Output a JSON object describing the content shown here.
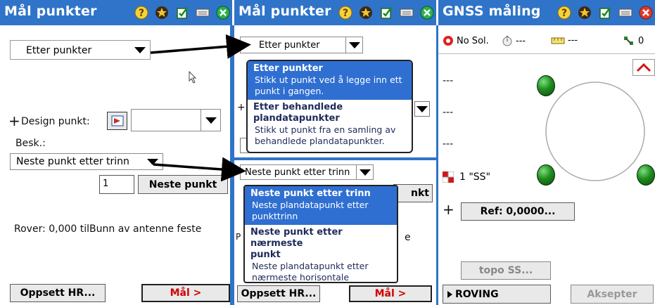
{
  "left": {
    "title": "Mål punkter",
    "method_dropdown": "Etter punkter",
    "plus": "+",
    "design_label": "Design punkt:",
    "besk_label": "Besk.:",
    "step_dropdown": "Neste punkt etter trinn",
    "number_value": "1",
    "next_button": "Neste punkt",
    "rover_text": "Rover: 0,000 tilBunn av antenne feste",
    "setup_button": "Oppsett HR...",
    "measure_button": "Mål >"
  },
  "middle": {
    "title": "Mål punkter",
    "method_dropdown": "Etter punkter",
    "method_options": [
      {
        "title": "Etter punkter",
        "desc_line1": "Stikk ut punkt ved å legge inn ett",
        "desc_line2": "punkt i gangen."
      },
      {
        "title_line1": "Etter behandlede",
        "title_line2": "plandatapunkter",
        "desc_line1": "Stikk ut punkt fra en samling av",
        "desc_line2": "behandlede plandatapunkter."
      }
    ],
    "step_dropdown": "Neste punkt etter trinn",
    "step_options": [
      {
        "title": "Neste punkt etter trinn",
        "desc_line1": "Neste plandatapunkt etter",
        "desc_line2": "punkttrinn"
      },
      {
        "title_line1": "Neste punkt etter nærmeste",
        "title_line2": "punkt",
        "desc_line1": "Neste plandatapunkt etter",
        "desc_line2": "nærmeste horisontale distanse."
      }
    ],
    "next_button_partial": "nkt",
    "partial_p": "P",
    "partial_e": "e",
    "partial_dash": "+",
    "setup_button": "Oppsett HR...",
    "measure_button": "Mål >"
  },
  "right": {
    "title": "GNSS måling",
    "status_solution": "No Sol.",
    "status_timer": "---",
    "status_ruler": "---",
    "status_sats": "0",
    "dash1": "---",
    "dash2": "---",
    "dash3": "---",
    "point_label": "1 \"SS\"",
    "plus": "+",
    "ref_button": "Ref: 0,0000...",
    "topo_button": "topo SS...",
    "roving_button": "ROVING",
    "accept_button": "Aksepter"
  },
  "colors": {
    "titlebar": "#2f74c8",
    "selected": "#2f6fd2",
    "measure_red": "#d00000"
  }
}
